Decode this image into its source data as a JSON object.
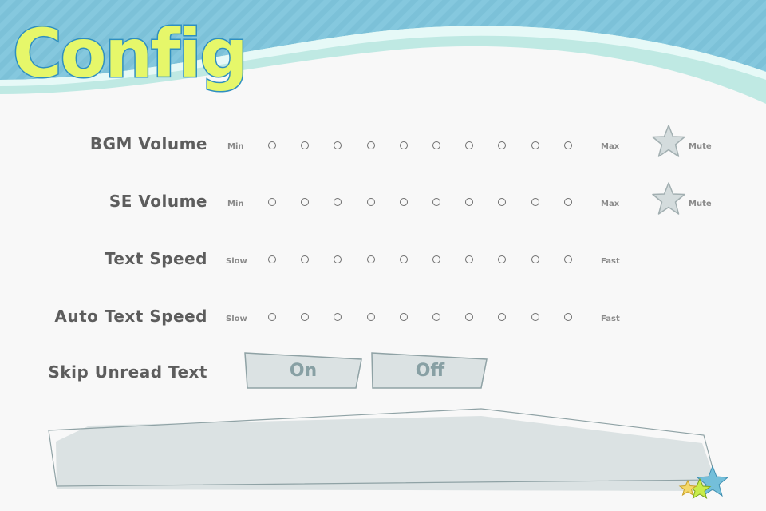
{
  "title": "Config",
  "rows": [
    {
      "label": "BGM Volume",
      "min_label": "Min",
      "max_label": "Max",
      "mute_label": "Mute",
      "steps": 10
    },
    {
      "label": "SE Volume",
      "min_label": "Min",
      "max_label": "Max",
      "mute_label": "Mute",
      "steps": 10
    },
    {
      "label": "Text Speed",
      "min_label": "Slow",
      "max_label": "Fast",
      "steps": 10
    },
    {
      "label": "Auto Text Speed",
      "min_label": "Slow",
      "max_label": "Fast",
      "steps": 10
    }
  ],
  "skip": {
    "label": "Skip Unread Text",
    "on_label": "On",
    "off_label": "Off"
  },
  "colors": {
    "header_blue": "#85c8de",
    "wave_mint": "#bfe9e3",
    "title_yellow": "#e6f76a",
    "panel_gray": "#dbe2e3",
    "star_gray": "#d4dcdd",
    "text_gray": "#5d5d5d"
  },
  "icons": {
    "mute": "star-icon",
    "decor": "star-icon"
  }
}
